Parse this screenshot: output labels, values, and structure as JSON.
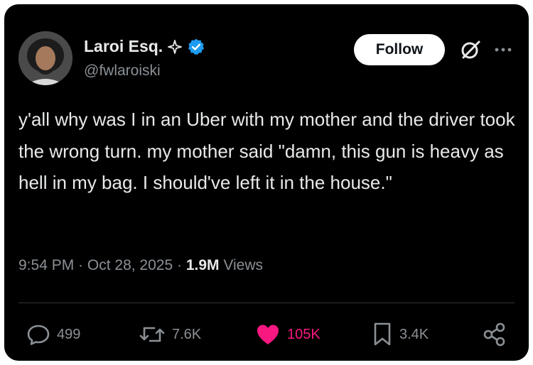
{
  "author": {
    "display_name": "Laroi Esq.",
    "handle": "@fwlaroiski"
  },
  "header": {
    "follow_label": "Follow"
  },
  "tweet": {
    "text": "y'all why was I in an Uber with my mother and the driver took the wrong turn. my mother said \"damn, this gun is heavy as hell in my bag. I should've left it in the house.\"",
    "time": "9:54 PM",
    "date": "Oct 28, 2025",
    "views_count": "1.9M",
    "views_label": "Views",
    "separator": " · "
  },
  "actions": {
    "replies": "499",
    "reposts": "7.6K",
    "likes": "105K",
    "bookmarks": "3.4K"
  },
  "colors": {
    "background": "#000000",
    "text": "#e7e9ea",
    "muted": "#8b9095",
    "verified": "#1d9bf0",
    "like": "#f91880"
  },
  "icons": [
    "sparkle-icon",
    "verified-icon",
    "grok-icon",
    "more-icon",
    "reply-icon",
    "repost-icon",
    "heart-icon",
    "bookmark-icon",
    "share-icon"
  ]
}
